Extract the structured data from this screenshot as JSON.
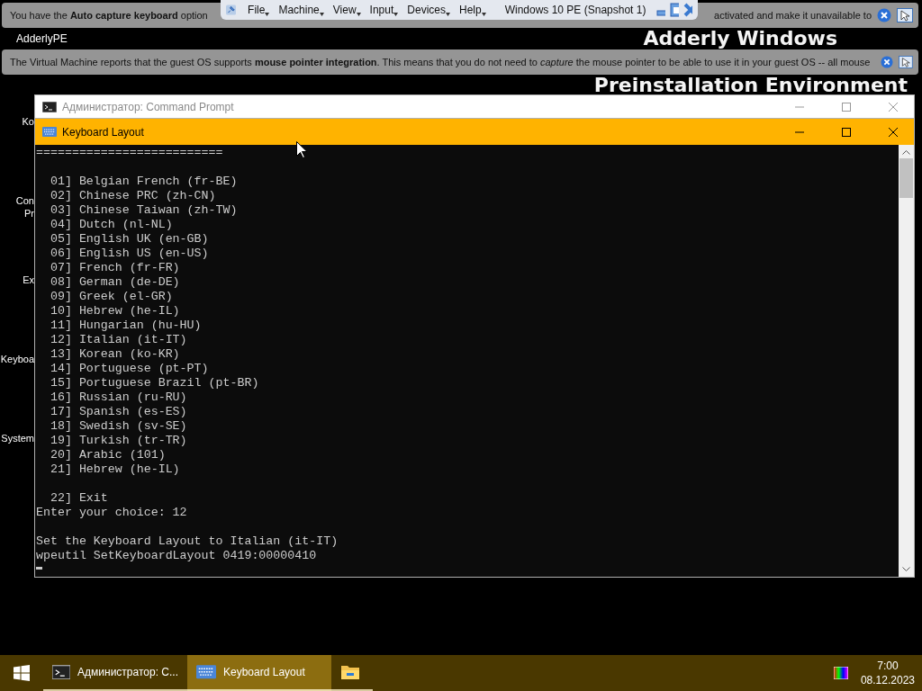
{
  "vm_toolbar": {
    "menus": [
      "File",
      "Machine",
      "View",
      "Input",
      "Devices",
      "Help"
    ],
    "title": "Windows 10 PE (Snapshot 1)"
  },
  "notifications": [
    {
      "parts": [
        "You have the **Auto capture keyboard** option",
        "activated and make it unavailable to"
      ]
    },
    {
      "parts": [
        "The Virtual Machine reports that the guest OS supports **mouse pointer integration**. This means that you do not need to *capture* the mouse pointer to be able to use it in your guest OS -- all mouse"
      ]
    }
  ],
  "desktop": {
    "branding": [
      "Adderly Windows",
      "Preinstallation Environment"
    ],
    "top_icon_label": "AdderlyPE",
    "icon_labels": [
      [
        "Ko"
      ],
      [
        "Con",
        "Pr"
      ],
      [
        "Ex"
      ],
      [
        "Keyboa"
      ],
      [
        "System"
      ]
    ]
  },
  "windows": [
    {
      "title": "Администратор: Command Prompt",
      "kind": "console",
      "active": false
    },
    {
      "title": "Keyboard Layout",
      "kind": "keyboard",
      "active": true,
      "console": [
        [
          "=========================="
        ],
        [
          "  01] Belgian French (fr-BE)",
          "  02] Chinese PRC (zh-CN)",
          "  03] Chinese Taiwan (zh-TW)",
          "  04] Dutch (nl-NL)",
          "  05] English UK (en-GB)",
          "  06] English US (en-US)",
          "  07] French (fr-FR)",
          "  08] German (de-DE)",
          "  09] Greek (el-GR)",
          "  10] Hebrew (he-IL)",
          "  11] Hungarian (hu-HU)",
          "  12] Italian (it-IT)",
          "  13] Korean (ko-KR)",
          "  14] Portuguese (pt-PT)",
          "  15] Portuguese Brazil (pt-BR)",
          "  16] Russian (ru-RU)",
          "  17] Spanish (es-ES)",
          "  18] Swedish (sv-SE)",
          "  19] Turkish (tr-TR)",
          "  20] Arabic (101)",
          "  21] Hebrew (he-IL)"
        ],
        [
          "  22] Exit",
          "Enter your choice: 12"
        ],
        [
          "Set the Keyboard Layout to Italian (it-IT)",
          "wpeutil SetKeyboardLayout 0419:00000410"
        ]
      ]
    }
  ],
  "taskbar": {
    "items": [
      {
        "kind": "console",
        "label": "Администратор: C...",
        "selected": false
      },
      {
        "kind": "keyboard",
        "label": "Keyboard Layout",
        "selected": true
      },
      {
        "kind": "folder",
        "selected": false
      }
    ],
    "time": "7:00",
    "date": "08.12.2023"
  }
}
